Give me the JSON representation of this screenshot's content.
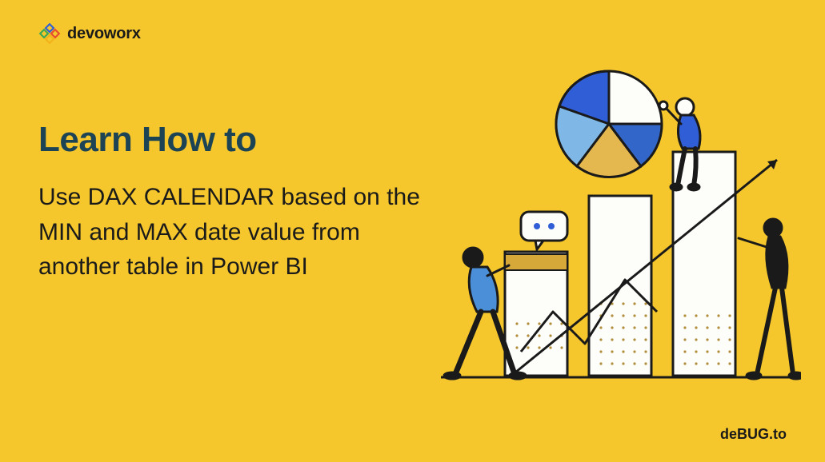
{
  "brand": {
    "name": "devoworx"
  },
  "headline": "Learn How to",
  "subtext": "Use DAX CALENDAR based on the MIN and MAX date value from another table in Power BI",
  "footer": {
    "prefix": "de",
    "mid": "BUG",
    "suffix": ".to"
  }
}
